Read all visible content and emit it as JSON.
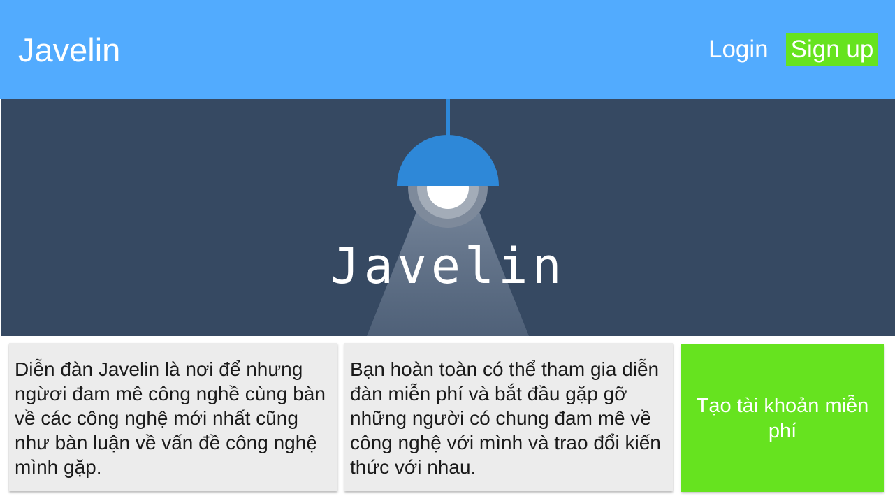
{
  "header": {
    "brand": "Javelin",
    "login_label": "Login",
    "signup_label": "Sign up"
  },
  "hero": {
    "title": "Javelin",
    "icon": "lamp-icon"
  },
  "cards": [
    {
      "text": "Diễn đàn Javelin là nơi để nhưng ngừơi đam mê công nghề cùng bàn về các công nghệ mới nhất cũng như bàn luận về vấn đề công nghệ mình gặp."
    },
    {
      "text": "Bạn hoàn toàn có thể tham gia diễn đàn miễn phí và bắt đầu gặp gỡ những người có chung đam mê về công nghệ với mình và trao đổi kiến thức với nhau."
    }
  ],
  "cta": {
    "label": "Tạo tài khoản miễn phí"
  },
  "colors": {
    "header_bg": "#52abfe",
    "hero_bg": "#364962",
    "accent_green": "#66e31f",
    "lamp_blue": "#2e88d8",
    "card_bg": "#ececec"
  }
}
